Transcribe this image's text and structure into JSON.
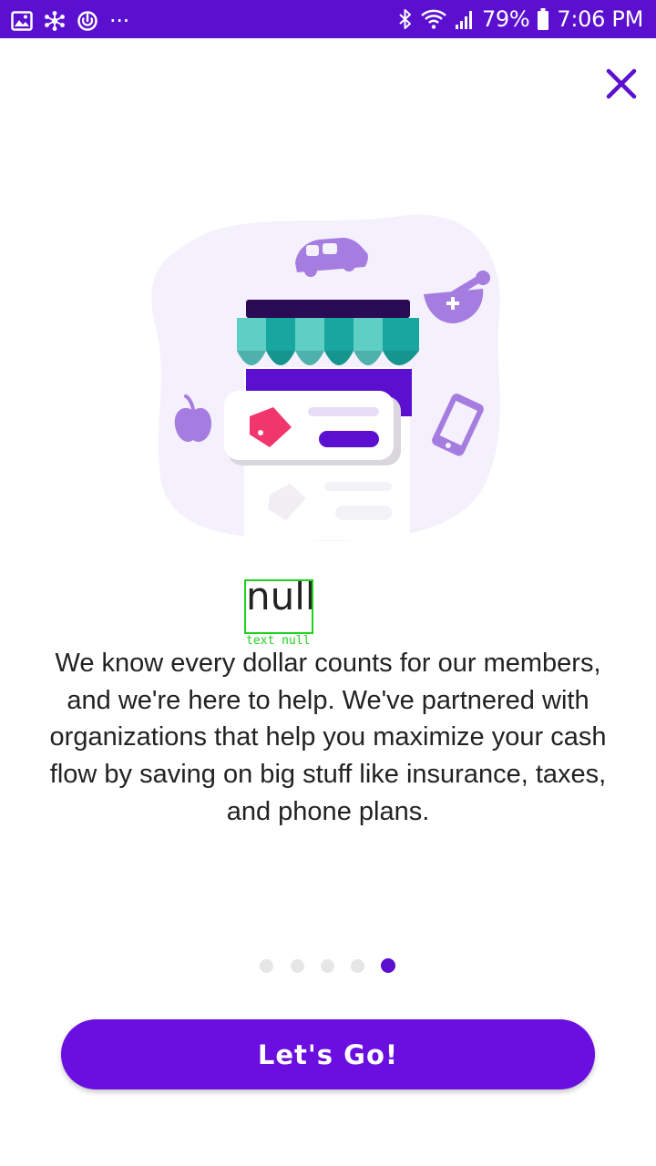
{
  "status_bar": {
    "battery": "79%",
    "time": "7:06 PM",
    "more": "···",
    "left_icons": [
      "gallery-icon",
      "network-icon",
      "sync-icon"
    ],
    "right_icons": [
      "bluetooth-icon",
      "wifi-icon",
      "signal-icon",
      "battery-icon"
    ]
  },
  "onboarding": {
    "annotation_text": "null",
    "annotation_label": "text null",
    "description": "We know every dollar counts for our members, and we're here to help. We've partnered with organizations that help you maximize your cash flow by saving on big stuff like insurance, taxes, and phone plans.",
    "page_count": 5,
    "current_page": 5,
    "cta_label": "Let's Go!"
  },
  "colors": {
    "brand": "#5b10d0",
    "button": "#6a0fe0",
    "awning_teal": "#1aa7a0",
    "tag_pink": "#f0366d",
    "icon_lavender": "#a57ce0"
  },
  "illustration_icons": [
    "car-icon",
    "mortar-pestle-icon",
    "apple-icon",
    "phone-icon",
    "storefront-icon",
    "price-tag-icon"
  ]
}
